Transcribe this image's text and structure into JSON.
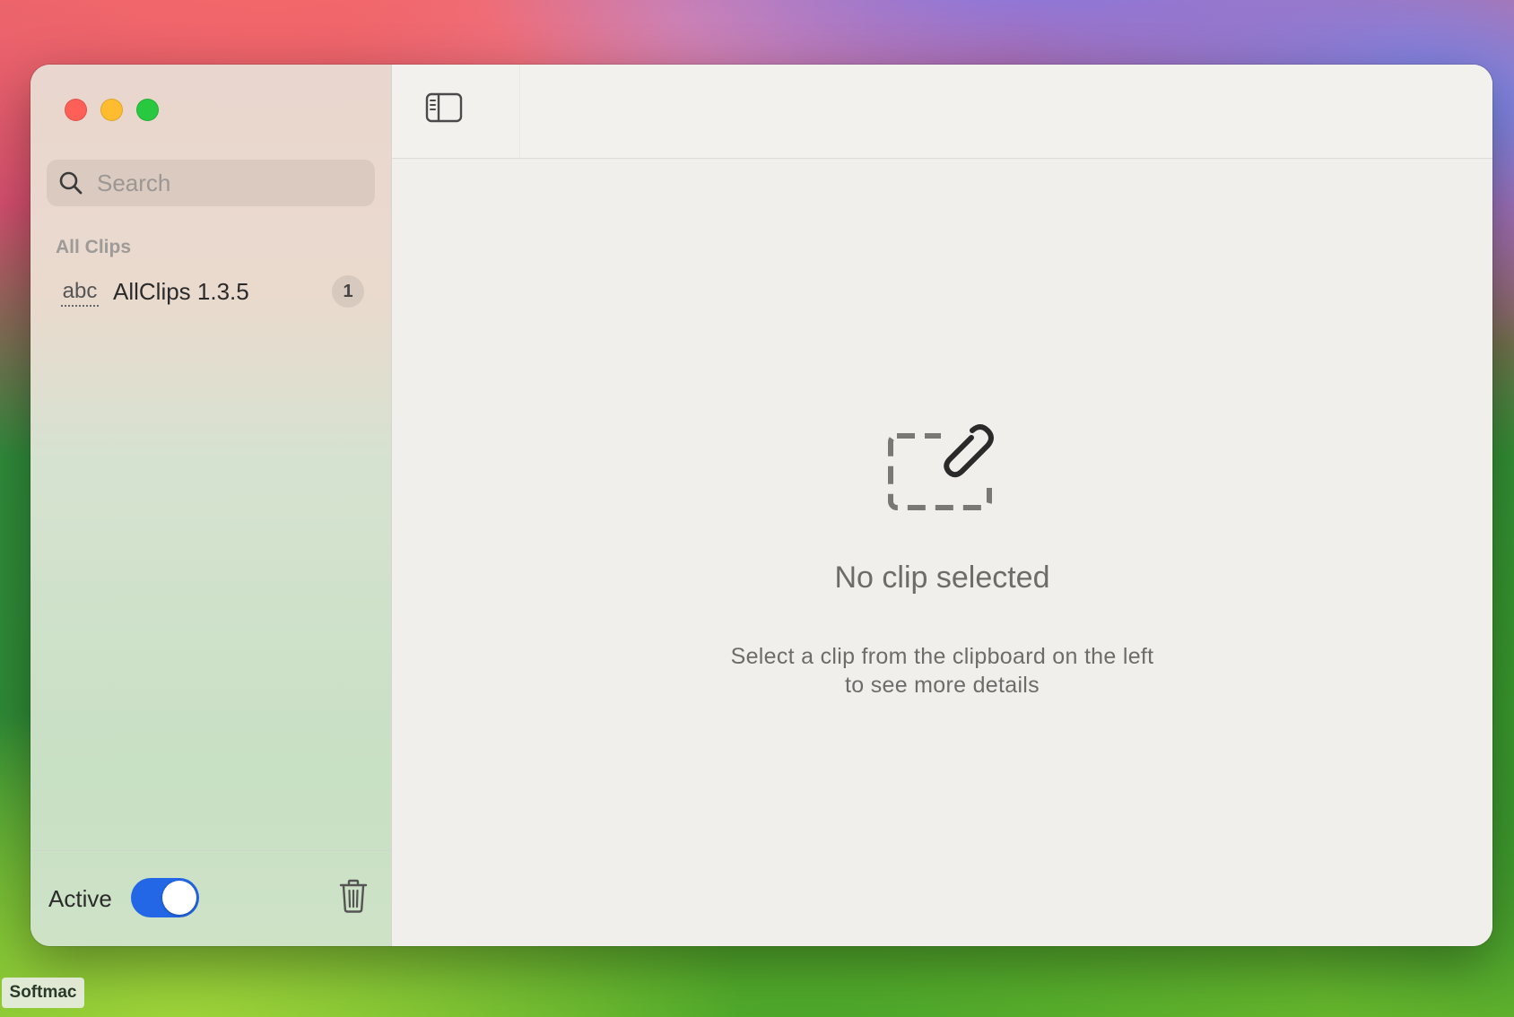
{
  "window": {
    "traffic_lights": {
      "close": "#fe5f57",
      "minimize": "#febc2e",
      "zoom": "#28c840"
    }
  },
  "sidebar": {
    "search": {
      "placeholder": "Search",
      "value": "",
      "icon": "search-icon"
    },
    "section_label": "All Clips",
    "clips": [
      {
        "type_icon": "abc",
        "title": "AllClips 1.3.5",
        "count": "1"
      }
    ],
    "footer": {
      "active_label": "Active",
      "active_toggle_on": true,
      "trash_icon": "trash-icon"
    }
  },
  "toolbar": {
    "sidebar_toggle_icon": "sidebar-toggle-icon"
  },
  "detail": {
    "empty_icon": "paperclip-dashed-icon",
    "empty_title": "No clip selected",
    "empty_line1": "Select a clip from the clipboard on the left",
    "empty_line2": "to see more details"
  },
  "watermark": "Softmac",
  "colors": {
    "accent": "#2367e6",
    "text_primary": "#2b2b2b",
    "text_secondary": "#6e6c6a"
  }
}
